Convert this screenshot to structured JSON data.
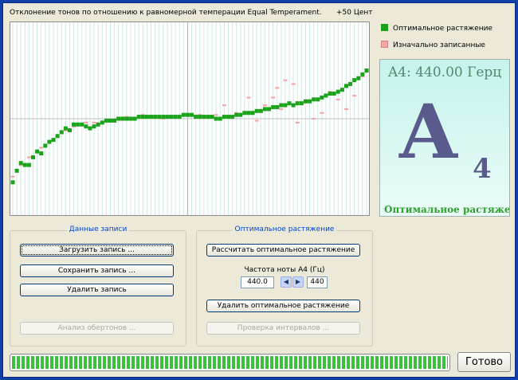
{
  "header": {
    "title": "Отклонение тонов по отношению к равномерной темперации Equal Temperament.",
    "cent_label": "+50 Цент"
  },
  "legend": {
    "items": [
      {
        "label": "Оптимальное растяжение",
        "color": "#1aa21a"
      },
      {
        "label": "Изначально записанные",
        "color": "#f5a6a6"
      }
    ]
  },
  "note_panel": {
    "frequency": "A4: 440.00 Герц",
    "letter": "A",
    "octave": "4",
    "mode": "Оптимальное растяже"
  },
  "recording_group": {
    "title": "Данные записи",
    "load_button": "Загрузить запись ...",
    "save_button": "Сохранить запись ...",
    "delete_button": "Удалить запись",
    "overtone_button": "Анализ обертонов ..."
  },
  "stretch_group": {
    "title": "Оптимальное растяжение",
    "calculate_button": "Рассчитать оптимальное растяжение",
    "a4_label": "Частота ноты A4 (Гц)",
    "a4_value": "440.0",
    "a4_spin_down": "◀",
    "a4_spin_up": "▶",
    "a4_display": "440",
    "delete_button": "Удалить оптимальное растяжение",
    "intervals_button": "Проверка интервалов ..."
  },
  "progress": {
    "fraction": 1.0
  },
  "status": "Готово",
  "chart_data": {
    "type": "scatter",
    "ylim": [
      -50,
      50
    ],
    "grid": true,
    "x_count": 88,
    "series": [
      {
        "name": "Оптимальное растяжение",
        "color": "#1aa21a",
        "x": [
          0,
          1,
          2,
          3,
          4,
          5,
          6,
          7,
          8,
          9,
          10,
          11,
          12,
          13,
          14,
          15,
          16,
          17,
          18,
          19,
          20,
          21,
          22,
          23,
          24,
          25,
          26,
          27,
          28,
          29,
          30,
          31,
          32,
          33,
          34,
          35,
          36,
          37,
          38,
          39,
          40,
          41,
          42,
          43,
          44,
          45,
          46,
          47,
          48,
          49,
          50,
          51,
          52,
          53,
          54,
          55,
          56,
          57,
          58,
          59,
          60,
          61,
          62,
          63,
          64,
          65,
          66,
          67,
          68,
          69,
          70,
          71,
          72,
          73,
          74,
          75,
          76,
          77,
          78,
          79,
          80,
          81,
          82,
          83,
          84,
          85,
          86,
          87
        ],
        "values": [
          -33,
          -27,
          -23,
          -24,
          -24,
          -20,
          -17,
          -18,
          -14,
          -12,
          -11,
          -9,
          -7,
          -5,
          -6,
          -3,
          -3,
          -3,
          -4,
          -5,
          -4,
          -3,
          -2,
          -1,
          -1,
          -1,
          0,
          0,
          0,
          0,
          0,
          1,
          1,
          1,
          1,
          1,
          1,
          1,
          1,
          1,
          1,
          1,
          2,
          2,
          2,
          1,
          1,
          1,
          1,
          1,
          0,
          0,
          1,
          1,
          1,
          2,
          2,
          3,
          3,
          3,
          4,
          4,
          5,
          5,
          6,
          6,
          7,
          7,
          8,
          7,
          8,
          8,
          9,
          9,
          10,
          10,
          11,
          12,
          13,
          13,
          14,
          15,
          17,
          18,
          20,
          21,
          23,
          25
        ]
      },
      {
        "name": "Изначально записанные",
        "color": "#f5a6a6",
        "x": [
          0,
          2,
          4,
          7,
          9,
          11,
          13,
          15,
          18,
          20,
          24,
          28,
          32,
          37,
          42,
          46,
          50,
          52,
          55,
          58,
          60,
          62,
          64,
          65,
          66,
          67,
          68,
          69,
          70,
          72,
          74,
          76,
          78,
          80,
          82,
          84,
          86
        ],
        "values": [
          -30,
          -24,
          -20,
          -15,
          -12,
          -9,
          -6,
          -4,
          -2,
          -2,
          -1,
          1,
          2,
          0,
          2,
          2,
          2,
          7,
          3,
          11,
          -1,
          7,
          11,
          16,
          5,
          20,
          8,
          18,
          -2,
          9,
          0,
          3,
          14,
          10,
          5,
          12,
          22
        ]
      }
    ]
  }
}
